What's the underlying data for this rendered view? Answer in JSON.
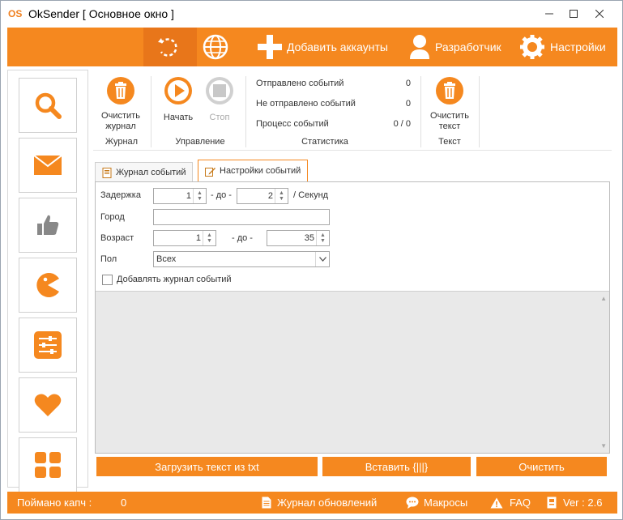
{
  "window": {
    "logo_text": "OS",
    "title": "OkSender [ Основное окно ]",
    "controls": {
      "minimize": "—",
      "maximize": "☐",
      "close": "✕"
    }
  },
  "toolbar": {
    "items": [
      {
        "label": "",
        "icon": "refresh-icon"
      },
      {
        "label": "",
        "icon": "globe-icon"
      },
      {
        "label": "Добавить аккаунты",
        "icon": "plus-icon"
      },
      {
        "label": "Разработчик",
        "icon": "user-icon"
      },
      {
        "label": "Настройки",
        "icon": "gear-icon"
      }
    ]
  },
  "sidebar": {
    "items": [
      {
        "icon": "search-icon"
      },
      {
        "icon": "envelope-icon"
      },
      {
        "icon": "thumbs-up-icon"
      },
      {
        "icon": "pacman-icon"
      },
      {
        "icon": "sliders-icon"
      },
      {
        "icon": "heart-icon"
      },
      {
        "icon": "grid-icon"
      }
    ]
  },
  "ribbon": {
    "journal": {
      "clear_label": "Очистить журнал",
      "group_label": "Журнал"
    },
    "control": {
      "start_label": "Начать",
      "stop_label": "Стоп",
      "group_label": "Управление"
    },
    "stats": {
      "group_label": "Статистика",
      "rows": [
        {
          "label": "Отправлено событий",
          "value": "0"
        },
        {
          "label": "Не отправлено событий",
          "value": "0"
        },
        {
          "label": "Процесс событий",
          "value": "0 / 0"
        }
      ]
    },
    "text": {
      "clear_label": "Очистить текст",
      "group_label": "Текст"
    }
  },
  "tabs": [
    {
      "label": "Журнал событий",
      "active": false
    },
    {
      "label": "Настройки событий",
      "active": true
    }
  ],
  "form": {
    "delay_label": "Задержка",
    "delay_from": "1",
    "delay_sep": "- до -",
    "delay_to": "2",
    "delay_unit": "/ Секунд",
    "city_label": "Город",
    "city_value": "",
    "age_label": "Возраст",
    "age_from": "1",
    "age_sep": "- до -",
    "age_to": "35",
    "gender_label": "Пол",
    "gender_value": "Всех",
    "add_log_label": "Добавлять журнал событий",
    "add_log_checked": false
  },
  "buttons": {
    "load_text": "Загрузить текст из txt",
    "insert": "Вставить {|||}",
    "clear": "Очистить"
  },
  "statusbar": {
    "captcha_label": "Поймано капч :",
    "captcha_value": "0",
    "updates": "Журнал обновлений",
    "macros": "Макросы",
    "faq": "FAQ",
    "version": "Ver : 2.6"
  },
  "colors": {
    "accent": "#f5881f",
    "accent_dark": "#e8761a"
  }
}
